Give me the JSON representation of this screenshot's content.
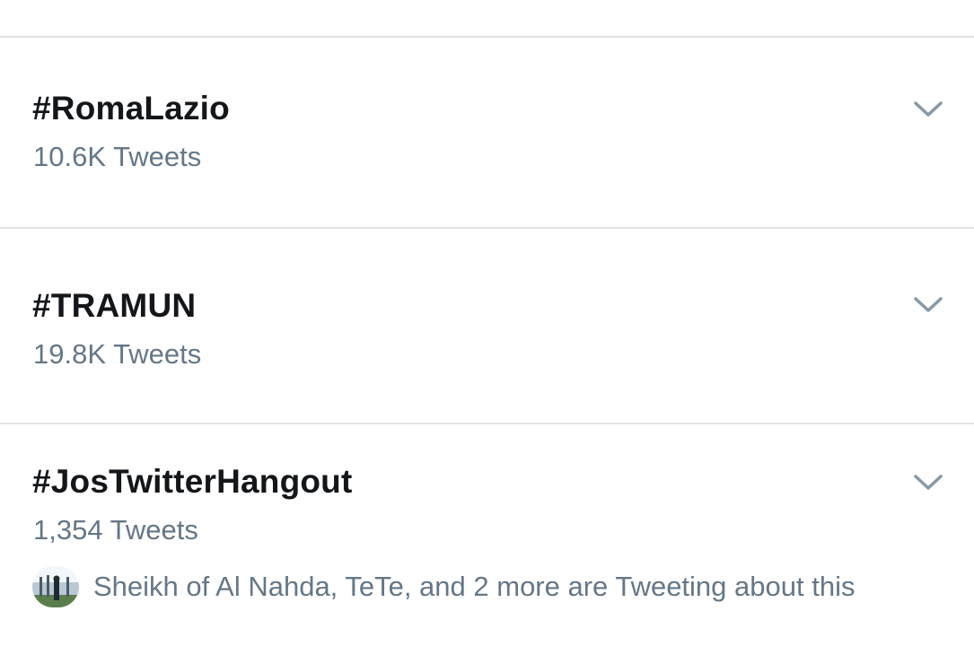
{
  "trends": [
    {
      "title": "#RomaLazio",
      "count": "10.6K Tweets",
      "more_icon": "chevron-down-icon"
    },
    {
      "title": "#TRAMUN",
      "count": "19.8K Tweets",
      "more_icon": "chevron-down-icon"
    },
    {
      "title": "#JosTwitterHangout",
      "count": "1,354 Tweets",
      "more_icon": "chevron-down-icon",
      "context": "Sheikh of Al Nahda, TeTe, and 2 more are Tweeting about this"
    }
  ],
  "colors": {
    "title": "#14171a",
    "secondary": "#657786",
    "divider": "#dfe3e7",
    "chevron": "#8899a6"
  }
}
